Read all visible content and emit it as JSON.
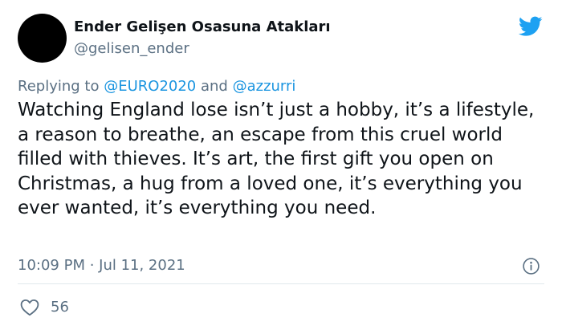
{
  "author": {
    "display_name": "Ender Gelişen Osasuna Atakları",
    "handle": "@gelisen_ender"
  },
  "reply": {
    "prefix": "Replying to",
    "mention_1": "@EURO2020",
    "conjunction": "and",
    "mention_2": "@azzurri"
  },
  "tweet": {
    "text": "Watching England lose isn’t just a hobby, it’s a lifestyle, a reason to breathe, an escape from this cruel world filled with thieves. It’s art, the first gift you open on Christmas, a hug from a loved one, it’s everything you ever wanted, it’s everything you need.",
    "timestamp": "10:09 PM · Jul 11, 2021"
  },
  "engagement": {
    "likes": "56"
  },
  "icons": {
    "brand": "twitter-bird-icon",
    "info": "info-icon",
    "like": "heart-icon"
  },
  "colors": {
    "text": "#0f1419",
    "secondary": "#5b7083",
    "link": "#1b95e0",
    "twitter_blue": "#1da1f2",
    "divider": "#e1e8ed"
  }
}
